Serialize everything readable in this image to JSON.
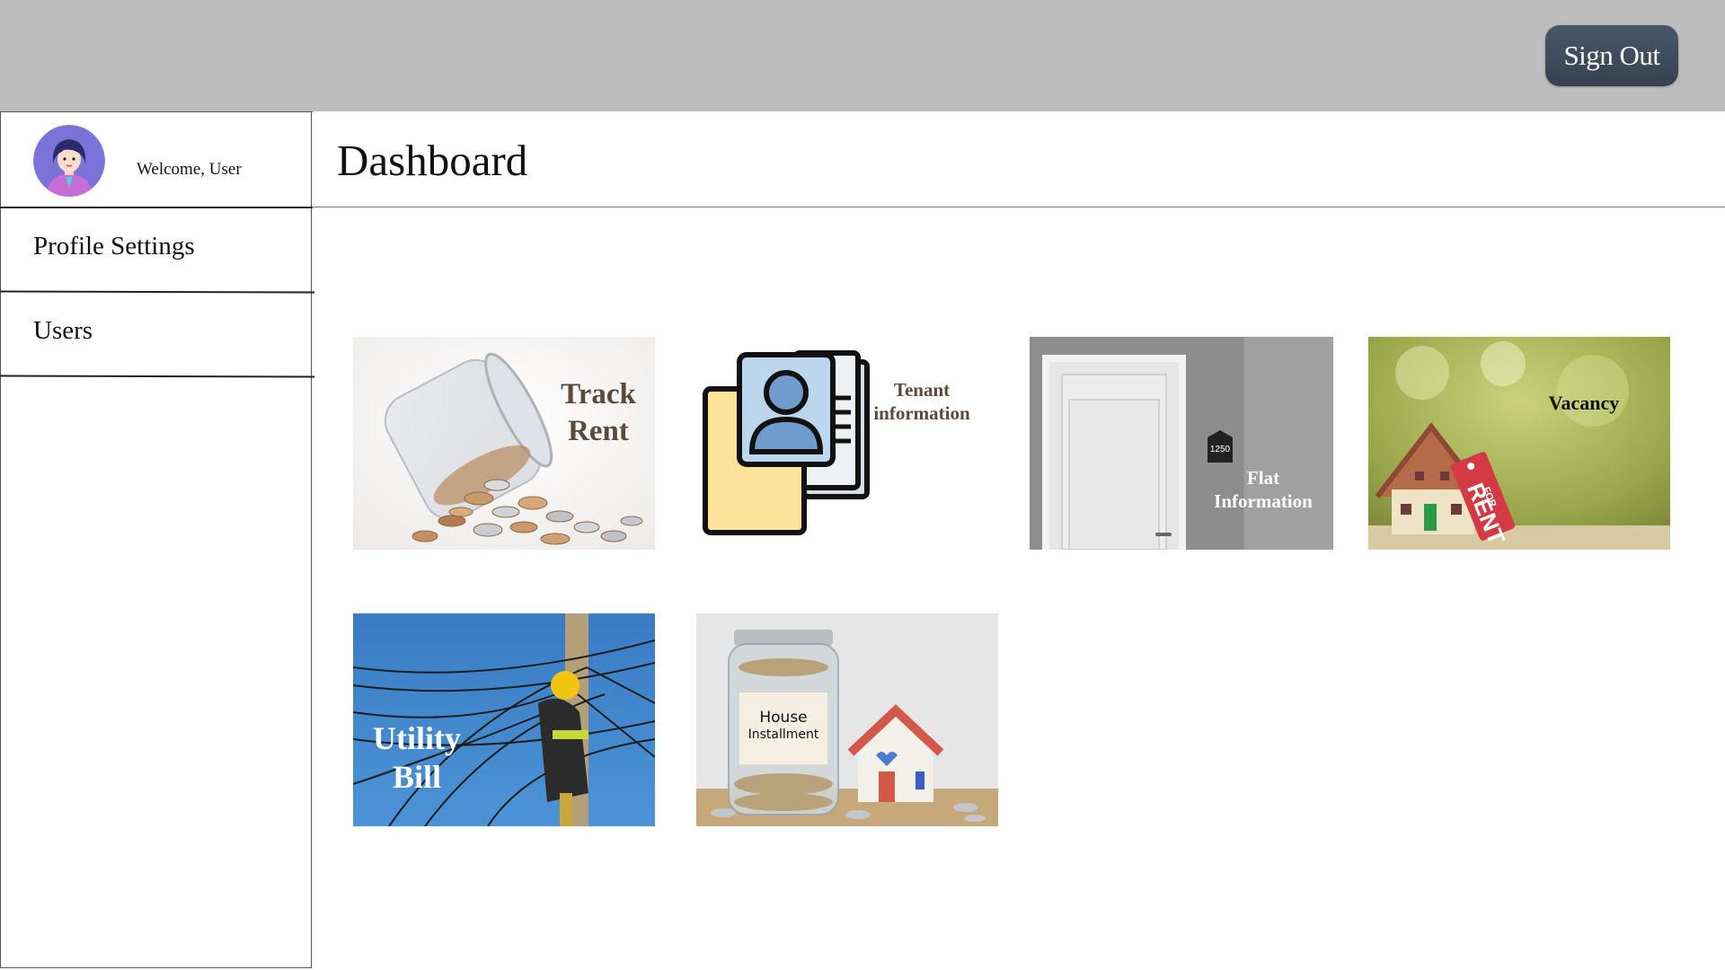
{
  "header": {
    "sign_out_label": "Sign Out"
  },
  "sidebar": {
    "welcome": "Welcome, User",
    "items": [
      {
        "label": "Profile Settings"
      },
      {
        "label": "Users"
      }
    ]
  },
  "main": {
    "title": "Dashboard",
    "tiles": [
      {
        "label_line1": "Track",
        "label_line2": "Rent"
      },
      {
        "label_line1": "Tenant",
        "label_line2": "information"
      },
      {
        "label_line1": "Flat",
        "label_line2": "Information",
        "door_number": "1250"
      },
      {
        "label": "Vacancy",
        "sign_small": "FOR",
        "sign_big": "RENT"
      },
      {
        "label_line1": "Utility",
        "label_line2": "Bill"
      },
      {
        "label_line1": "House",
        "label_line2": "Installment"
      }
    ]
  },
  "colors": {
    "topbar": "#bdbdbd",
    "sign_out_bg": "#3f4b5c"
  }
}
